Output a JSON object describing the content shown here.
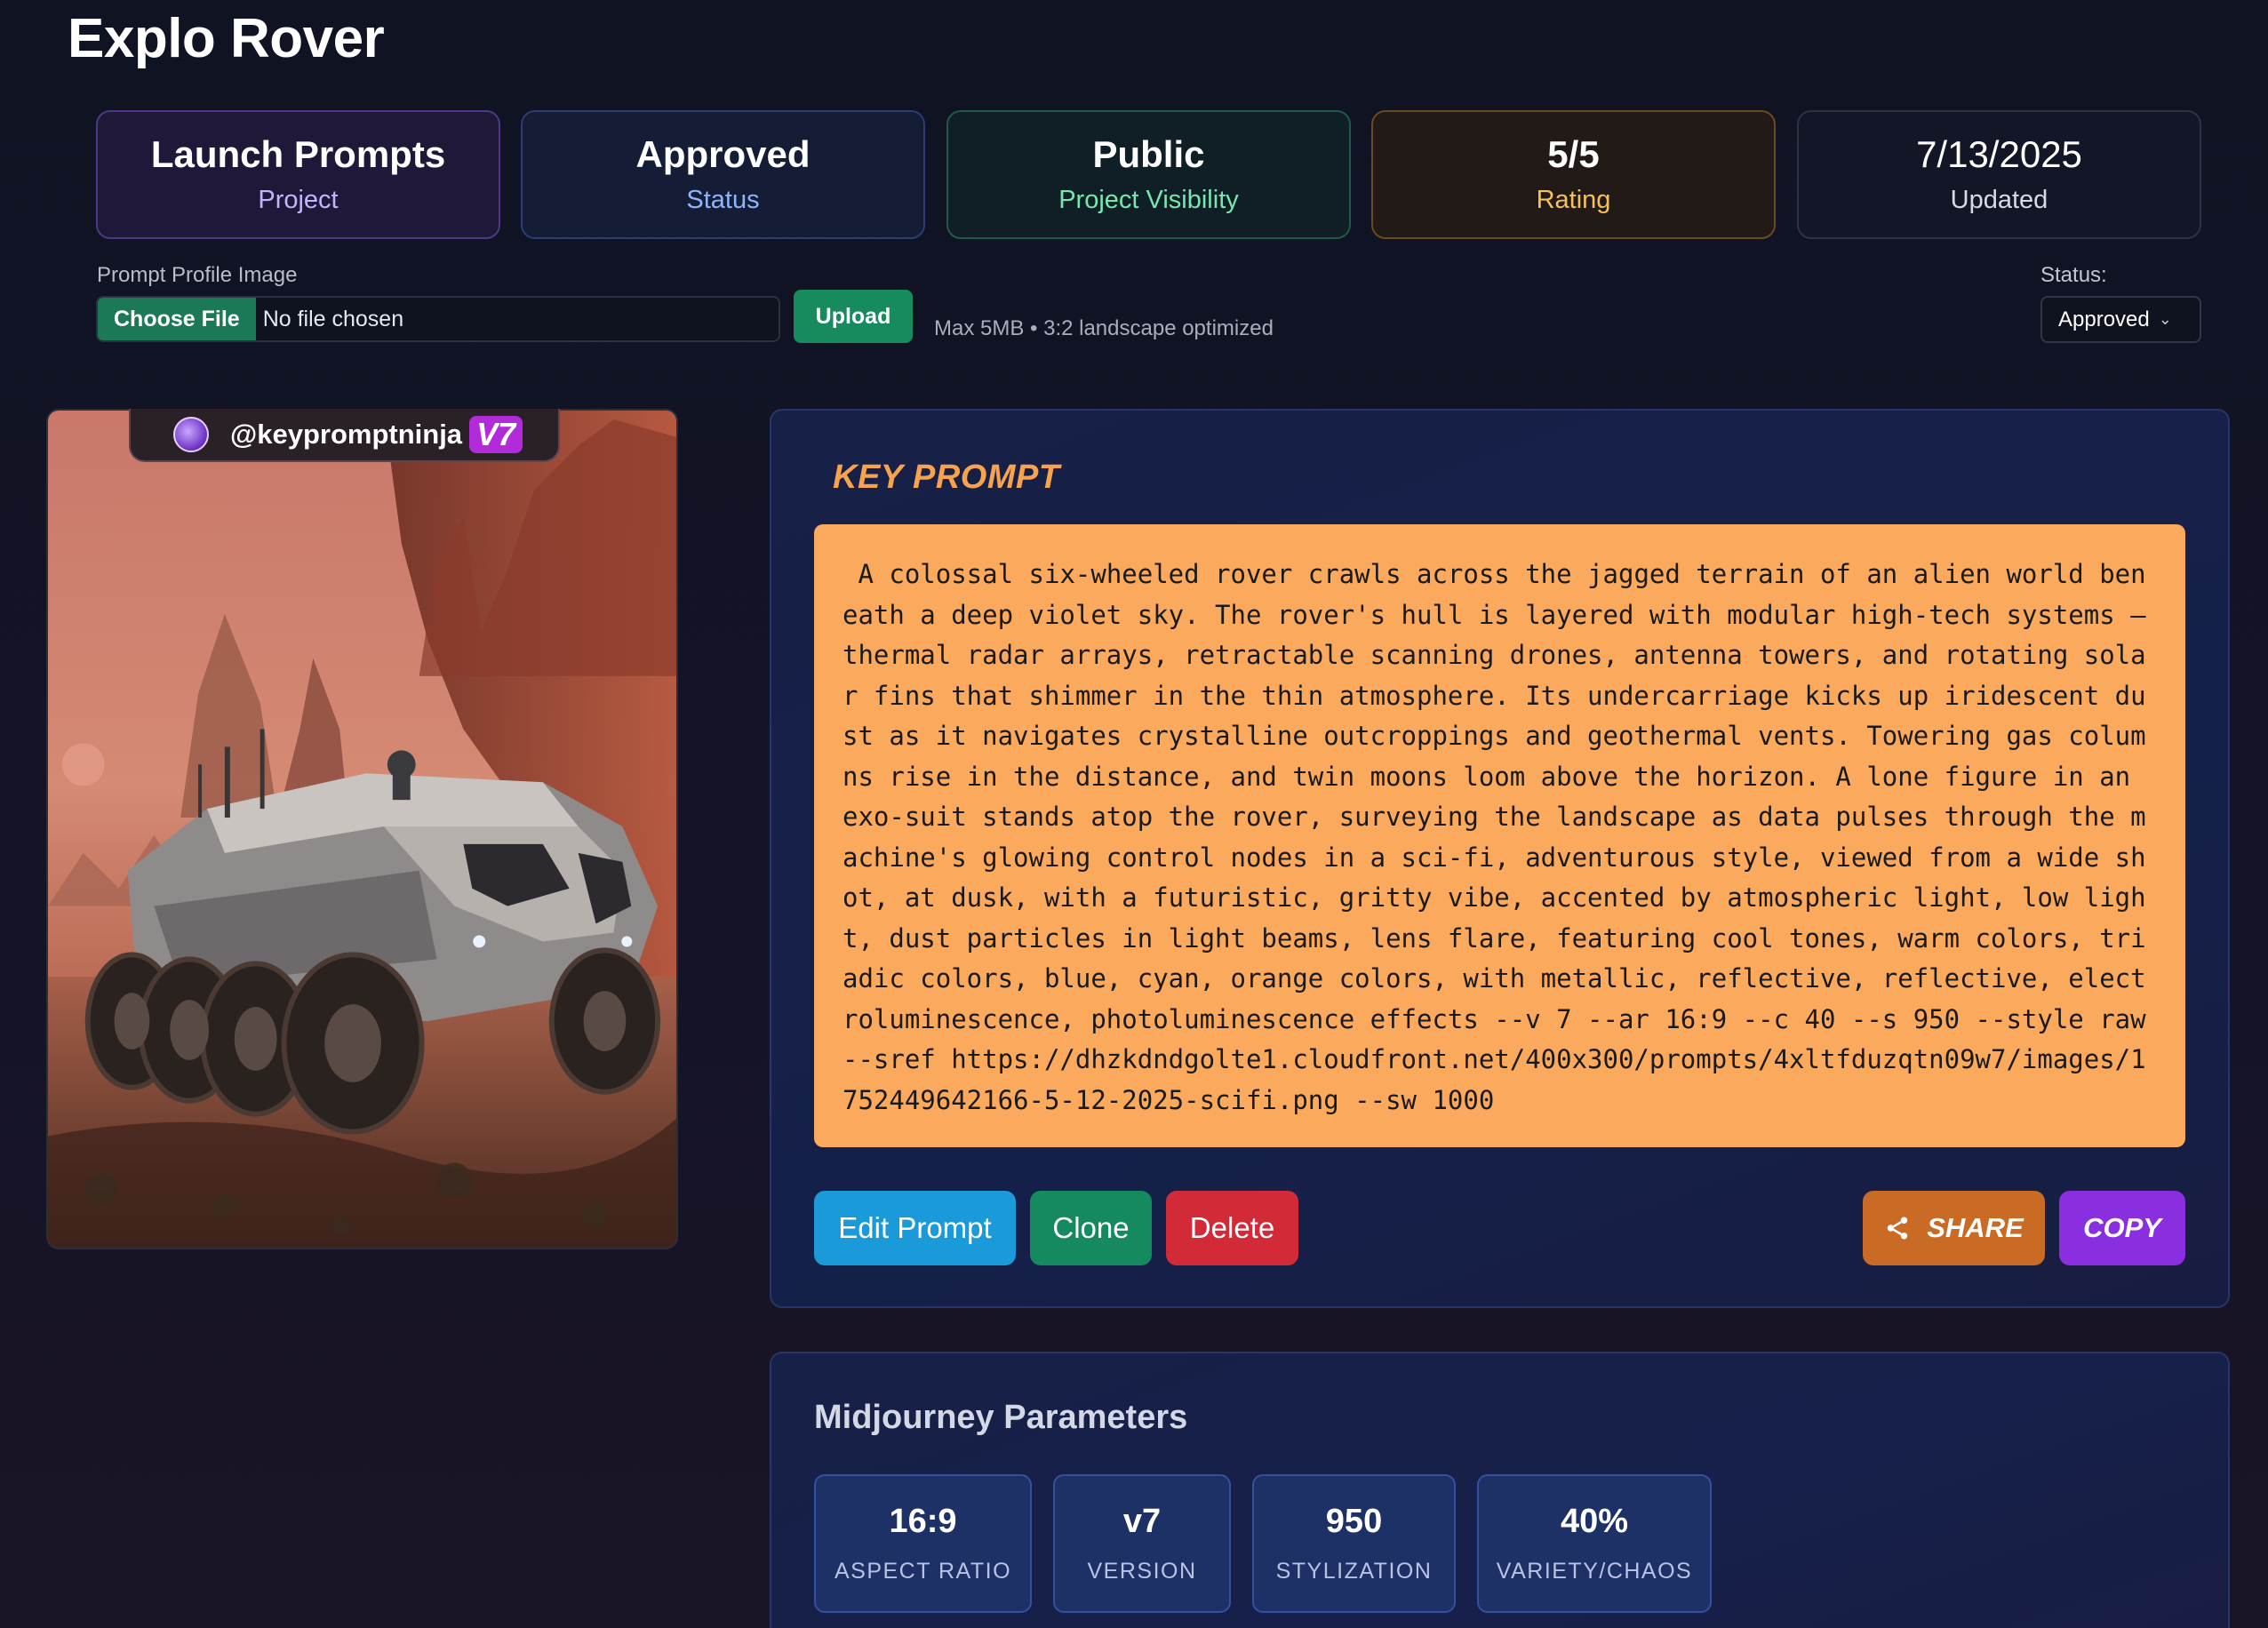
{
  "page": {
    "title": "Explo Rover"
  },
  "stats": [
    {
      "value": "Launch Prompts",
      "label": "Project"
    },
    {
      "value": "Approved",
      "label": "Status"
    },
    {
      "value": "Public",
      "label": "Project Visibility"
    },
    {
      "value": "5/5",
      "label": "Rating"
    },
    {
      "value": "7/13/2025",
      "label": "Updated"
    }
  ],
  "upload": {
    "label": "Prompt Profile Image",
    "choose_label": "Choose File",
    "file_status": "No file chosen",
    "button_label": "Upload",
    "hint": "Max 5MB • 3:2 landscape optimized"
  },
  "status_select": {
    "label": "Status:",
    "value": "Approved"
  },
  "image_card": {
    "author": "@keypromptninja",
    "version_badge": "V7"
  },
  "prompt": {
    "heading": "KEY PROMPT",
    "text": " A colossal six-wheeled rover crawls across the jagged terrain of an alien world beneath a deep violet sky. The rover's hull is layered with modular high-tech systems — thermal radar arrays, retractable scanning drones, antenna towers, and rotating solar fins that shimmer in the thin atmosphere. Its undercarriage kicks up iridescent dust as it navigates crystalline outcroppings and geothermal vents. Towering gas columns rise in the distance, and twin moons loom above the horizon. A lone figure in an exo-suit stands atop the rover, surveying the landscape as data pulses through the machine's glowing control nodes in a sci-fi, adventurous style, viewed from a wide shot, at dusk, with a futuristic, gritty vibe, accented by atmospheric light, low light, dust particles in light beams, lens flare, featuring cool tones, warm colors, triadic colors, blue, cyan, orange colors, with metallic, reflective, reflective, electroluminescence, photoluminescence effects --v 7 --ar 16:9 --c 40 --s 950 --style raw  --sref https://dhzkdndgolte1.cloudfront.net/400x300/prompts/4xltfduzqtn09w7/images/1752449642166-5-12-2025-scifi.png --sw 1000"
  },
  "actions": {
    "edit": "Edit Prompt",
    "clone": "Clone",
    "delete": "Delete",
    "share": "SHARE",
    "copy": "COPY"
  },
  "parameters": {
    "title": "Midjourney Parameters",
    "items": [
      {
        "value": "16:9",
        "label": "ASPECT RATIO"
      },
      {
        "value": "v7",
        "label": "VERSION"
      },
      {
        "value": "950",
        "label": "STYLIZATION"
      },
      {
        "value": "40%",
        "label": "VARIETY/CHAOS"
      }
    ]
  },
  "colors": {
    "accent_orange": "#f7a24d",
    "prompt_bg": "#fba95c",
    "edit": "#1a9ad9",
    "clone": "#168a5f",
    "delete": "#d32a38",
    "share": "#c96a25",
    "copy": "#8a2fe0"
  },
  "icons": {
    "share": "share-icon",
    "dropdown": "chevron-down-icon"
  }
}
